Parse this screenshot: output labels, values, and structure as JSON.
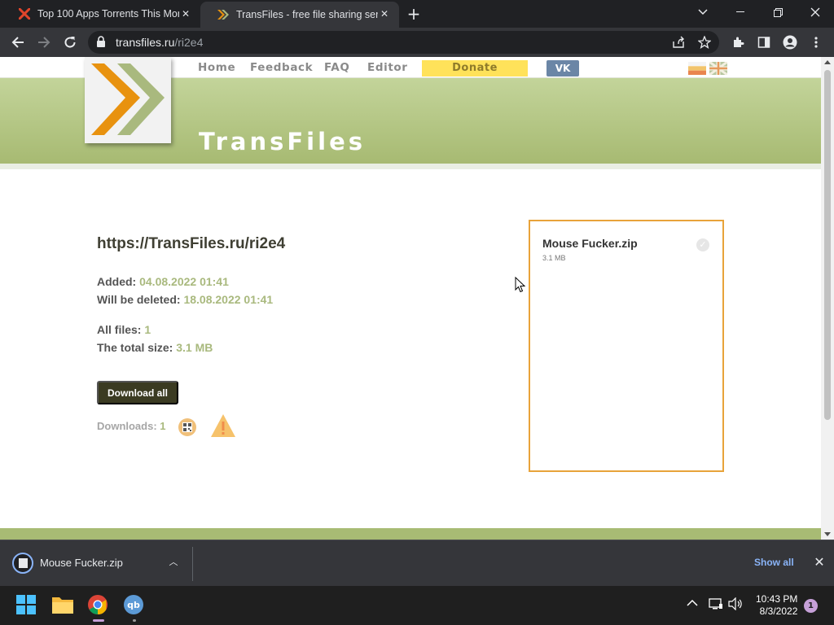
{
  "browser": {
    "tabs": [
      {
        "title": "Top 100 Apps Torrents This Mont",
        "favicon": "x-logo-icon",
        "active": false
      },
      {
        "title": "TransFiles - free file sharing servic",
        "favicon": "transfiles-chevrons-icon",
        "active": true
      }
    ],
    "address": {
      "host": "transfiles.ru",
      "path": "/ri2e4"
    }
  },
  "site": {
    "nav": [
      {
        "label": "Home"
      },
      {
        "label": "Feedback"
      },
      {
        "label": "FAQ"
      },
      {
        "label": "Editor"
      }
    ],
    "donate_label": "Donate",
    "vk_label": "VK",
    "name": "TransFiles",
    "colors": {
      "accent_green": "#a7ba72",
      "donate_yellow": "#ffe25a",
      "file_border": "#e8a33a",
      "button_dark": "#3b3b22"
    }
  },
  "share": {
    "link": "https://TransFiles.ru/ri2e4",
    "added_label": "Added:",
    "added_value": "04.08.2022 01:41",
    "deleted_label": "Will be deleted:",
    "deleted_value": "18.08.2022 01:41",
    "files_label": "All files:",
    "files_value": "1",
    "size_label": "The total size:",
    "size_value": "3.1 MB",
    "download_all_label": "Download all",
    "downloads_label": "Downloads:",
    "downloads_value": "1"
  },
  "files": [
    {
      "name": "Mouse Fucker.zip",
      "size": "3.1 MB"
    }
  ],
  "download_shelf": {
    "file_name": "Mouse Fucker.zip",
    "show_all_label": "Show all"
  },
  "taskbar": {
    "time": "10:43 PM",
    "date": "8/3/2022",
    "notification_count": "1"
  }
}
